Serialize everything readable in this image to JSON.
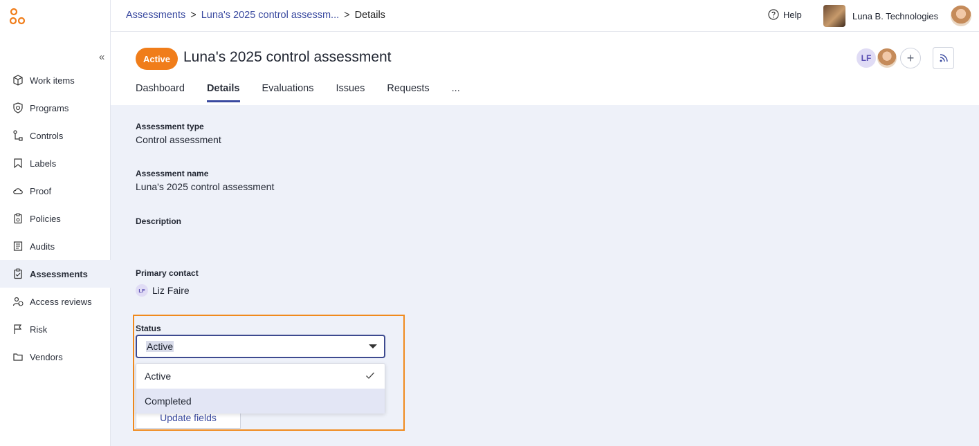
{
  "breadcrumb": {
    "items": [
      "Assessments",
      "Luna's 2025 control assessm...",
      "Details"
    ],
    "separator": ">"
  },
  "topbar": {
    "help_label": "Help",
    "org_name": "Luna B. Technologies"
  },
  "sidebar": {
    "collapse_glyph": "«",
    "items": [
      {
        "label": "Work items",
        "icon": "box-icon"
      },
      {
        "label": "Programs",
        "icon": "shield-icon"
      },
      {
        "label": "Controls",
        "icon": "flow-icon"
      },
      {
        "label": "Labels",
        "icon": "bookmark-icon"
      },
      {
        "label": "Proof",
        "icon": "cloud-icon"
      },
      {
        "label": "Policies",
        "icon": "clipboard-gear-icon"
      },
      {
        "label": "Audits",
        "icon": "document-list-icon"
      },
      {
        "label": "Assessments",
        "icon": "clipboard-check-icon",
        "active": true
      },
      {
        "label": "Access reviews",
        "icon": "user-check-icon"
      },
      {
        "label": "Risk",
        "icon": "flag-icon"
      },
      {
        "label": "Vendors",
        "icon": "folder-icon"
      }
    ]
  },
  "header": {
    "status": "Active",
    "title": "Luna's 2025 control assessment",
    "collaborator_initials": "LF",
    "add_glyph": "+",
    "tabs": [
      "Dashboard",
      "Details",
      "Evaluations",
      "Issues",
      "Requests",
      "..."
    ],
    "active_tab": "Details"
  },
  "details": {
    "assessment_type_label": "Assessment type",
    "assessment_type_value": "Control assessment",
    "assessment_name_label": "Assessment name",
    "assessment_name_value": "Luna's 2025 control assessment",
    "description_label": "Description",
    "primary_contact_label": "Primary contact",
    "primary_contact_initials": "LF",
    "primary_contact_name": "Liz Faire",
    "status_label": "Status",
    "status_value": "Active",
    "status_options": [
      "Active",
      "Completed"
    ],
    "selected_option": "Active",
    "update_button": "Update fields"
  },
  "colors": {
    "accent": "#3a4aa0",
    "status_orange": "#f07d1a",
    "highlight_border": "#f08a1d",
    "content_bg": "#eef1f9"
  }
}
